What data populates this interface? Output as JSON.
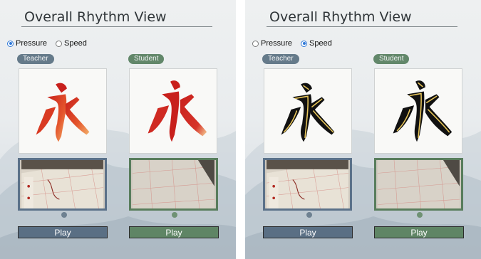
{
  "panels": [
    {
      "title": "Overall Rhythm View",
      "radios": [
        {
          "label": "Pressure",
          "selected": true
        },
        {
          "label": "Speed",
          "selected": false
        }
      ],
      "teacher_label": "Teacher",
      "student_label": "Student",
      "play_teacher": "Play",
      "play_student": "Play"
    },
    {
      "title": "Overall Rhythm View",
      "radios": [
        {
          "label": "Pressure",
          "selected": false
        },
        {
          "label": "Speed",
          "selected": true
        }
      ],
      "teacher_label": "Teacher",
      "student_label": "Student",
      "play_teacher": "Play",
      "play_student": "Play"
    }
  ],
  "colors": {
    "teacher": "#5b7189",
    "student": "#587d5c",
    "radio_selected": "#2f78d8",
    "pressure_high": "#c8201c",
    "pressure_low": "#f3b16b",
    "speed_stroke": "#111111",
    "speed_track": "#e8c65a"
  },
  "icons": {
    "glyph": "yong-character",
    "video": "brush-writing-video-frame"
  }
}
